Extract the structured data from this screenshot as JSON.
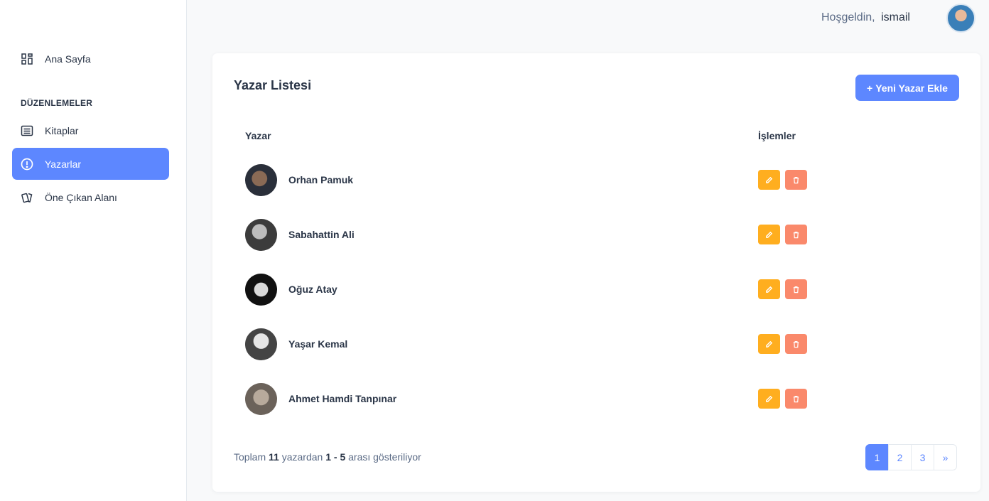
{
  "sidebar": {
    "items": [
      {
        "label": "Ana Sayfa",
        "icon": "dashboard-icon"
      },
      {
        "label": "Kitaplar",
        "icon": "list-icon"
      },
      {
        "label": "Yazarlar",
        "icon": "alert-circle-icon",
        "active": true
      },
      {
        "label": "Öne Çıkan Alanı",
        "icon": "cards-icon"
      }
    ],
    "section_title": "DÜZENLEMELER"
  },
  "header": {
    "welcome": "Hoşgeldin,",
    "username": "ismail"
  },
  "main": {
    "title": "Yazar Listesi",
    "add_button": "Yeni Yazar Ekle",
    "columns": [
      "Yazar",
      "İşlemler"
    ],
    "authors": [
      {
        "name": "Orhan Pamuk"
      },
      {
        "name": "Sabahattin Ali"
      },
      {
        "name": "Oğuz Atay"
      },
      {
        "name": "Yaşar Kemal"
      },
      {
        "name": "Ahmet Hamdi Tanpınar"
      }
    ],
    "footer": {
      "prefix": "Toplam",
      "total": "11",
      "middle": "yazardan",
      "range": "1 - 5",
      "suffix": "arası gösteriliyor"
    },
    "pagination": [
      "1",
      "2",
      "3",
      "»"
    ]
  },
  "colors": {
    "primary": "#5d87ff",
    "edit": "#ffae1f",
    "delete": "#fa896b"
  }
}
